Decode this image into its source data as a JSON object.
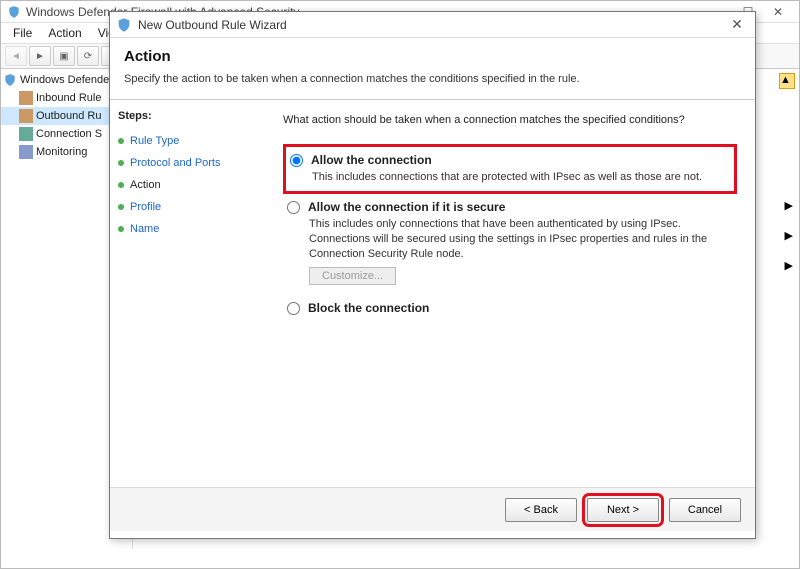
{
  "bg": {
    "title": "Windows Defender Firewall with Advanced Security",
    "menu": [
      "File",
      "Action",
      "View"
    ],
    "tree": {
      "root": "Windows Defender",
      "items": [
        "Inbound Rule",
        "Outbound Ru",
        "Connection S",
        "Monitoring"
      ]
    }
  },
  "wizard": {
    "title": "New Outbound Rule Wizard",
    "heading": "Action",
    "subheading": "Specify the action to be taken when a connection matches the conditions specified in the rule.",
    "steps_label": "Steps:",
    "steps": [
      "Rule Type",
      "Protocol and Ports",
      "Action",
      "Profile",
      "Name"
    ],
    "current_step": 2,
    "question": "What action should be taken when a connection matches the specified conditions?",
    "options": [
      {
        "title": "Allow the connection",
        "desc": "This includes connections that are protected with IPsec as well as those are not.",
        "checked": true
      },
      {
        "title": "Allow the connection if it is secure",
        "desc": "This includes only connections that have been authenticated by using IPsec. Connections will be secured using the settings in IPsec properties and rules in the Connection Security Rule node.",
        "checked": false
      },
      {
        "title": "Block the connection",
        "desc": "",
        "checked": false
      }
    ],
    "customize_label": "Customize...",
    "buttons": {
      "back": "< Back",
      "next": "Next >",
      "cancel": "Cancel"
    }
  }
}
